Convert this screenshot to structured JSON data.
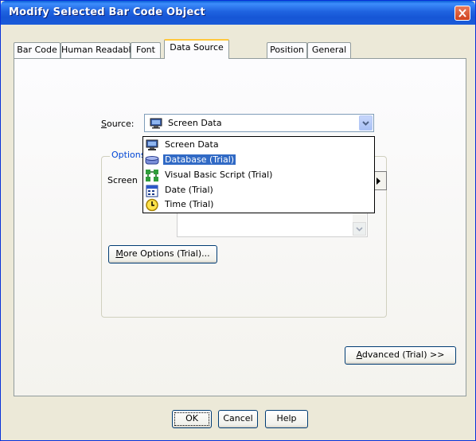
{
  "window": {
    "title": "Modify Selected Bar Code Object"
  },
  "tabs": [
    {
      "label": "Bar Code"
    },
    {
      "label": "Human Readable"
    },
    {
      "label": "Font"
    },
    {
      "label": "Data Source"
    },
    {
      "label": "Position"
    },
    {
      "label": "General"
    }
  ],
  "active_tab": "Data Source",
  "source": {
    "label_prefix": "S",
    "label_rest": "ource:",
    "value": "Screen Data"
  },
  "options_group": {
    "legend": "Options",
    "screen_label": "Screen"
  },
  "dropdown": {
    "items": [
      {
        "label": "Screen Data",
        "icon": "monitor-icon"
      },
      {
        "label": "Database (Trial)",
        "icon": "database-icon",
        "selected": true
      },
      {
        "label": "Visual Basic Script (Trial)",
        "icon": "script-icon"
      },
      {
        "label": "Date (Trial)",
        "icon": "calendar-icon"
      },
      {
        "label": "Time (Trial)",
        "icon": "clock-icon"
      }
    ]
  },
  "buttons": {
    "more_options_prefix": "M",
    "more_options_rest": "ore Options (Trial)...",
    "advanced_prefix": "A",
    "advanced_rest": "dvanced (Trial) >>",
    "ok": "OK",
    "cancel": "Cancel",
    "help": "Help"
  },
  "colors": {
    "title_bar": "#1f63e0",
    "selection": "#316ac5",
    "group_legend": "#0046d5",
    "active_tab_accent": "#ffc83c"
  }
}
